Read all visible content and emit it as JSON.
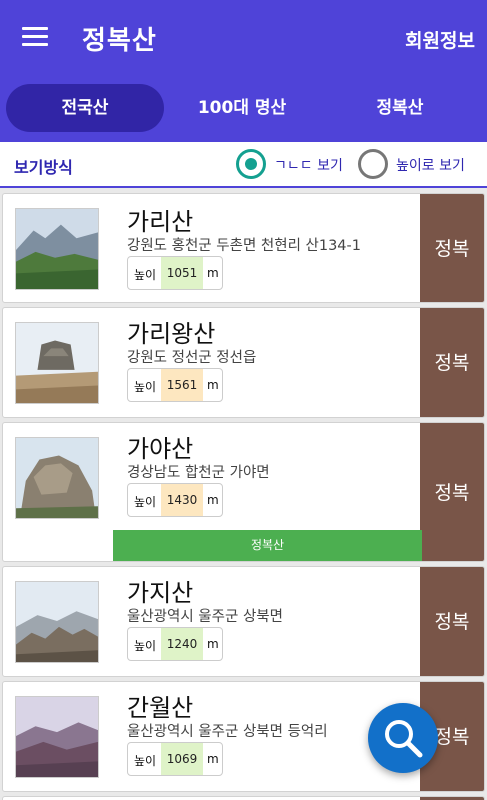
{
  "appbar": {
    "title": "정복산",
    "member_info": "회원정보",
    "menu_icon": "hamburger-menu-icon"
  },
  "tabs": [
    {
      "label": "전국산",
      "active": true
    },
    {
      "label": "100대 명산",
      "active": false
    },
    {
      "label": "정복산",
      "active": false
    }
  ],
  "view_mode": {
    "label": "보기방식",
    "options": [
      {
        "label": "ㄱㄴㄷ 보기",
        "checked": true
      },
      {
        "label": "높이로 보기",
        "checked": false
      }
    ]
  },
  "height_label": "높이",
  "height_unit": "m",
  "conquer_label": "정복",
  "conquered_label": "정복산",
  "mountains": [
    {
      "name": "가리산",
      "address": "강원도 홍천군 두촌면 천현리 산134-1",
      "height": "1051",
      "value_color": "#dff3c8",
      "conquered": false
    },
    {
      "name": "가리왕산",
      "address": "강원도 정선군 정선읍",
      "height": "1561",
      "value_color": "#fde7c0",
      "conquered": false
    },
    {
      "name": "가야산",
      "address": "경상남도 합천군 가야면",
      "height": "1430",
      "value_color": "#fde7c0",
      "conquered": true
    },
    {
      "name": "가지산",
      "address": "울산광역시 울주군 상북면",
      "height": "1240",
      "value_color": "#dff3c8",
      "conquered": false
    },
    {
      "name": "간월산",
      "address": "울산광역시 울주군 상북면 등억리",
      "height": "1069",
      "value_color": "#dff3c8",
      "conquered": false
    }
  ],
  "fab_icon": "search-icon",
  "colors": {
    "primary": "#4f43d8",
    "active_tab": "#3125a6",
    "conquer_button": "#795548",
    "conquered_bar": "#4caf50",
    "radio_checked": "#14a090",
    "fab": "#1270c9"
  }
}
